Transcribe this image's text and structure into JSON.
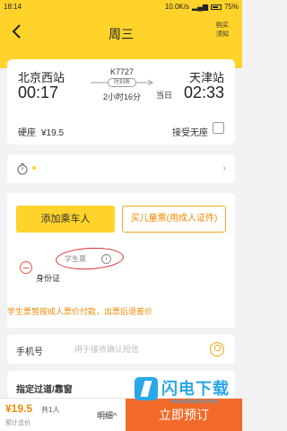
{
  "status_bar": {
    "time": "18:14",
    "speed": "10.0K/s",
    "battery": "75%"
  },
  "header": {
    "title": "周三",
    "help_line1": "购买",
    "help_line2": "须知"
  },
  "trip": {
    "from_station": "北京西站",
    "to_station": "天津站",
    "depart_time": "00:17",
    "arrive_time": "02:33",
    "arrive_day": "当日",
    "train_no": "K7727",
    "timetable_label": "时刻表",
    "duration": "2小时16分",
    "seat_type": "硬座",
    "price": "¥19.5",
    "accept_no_seat": "接受无座"
  },
  "passenger": {
    "add_button": "添加乘车人",
    "child_button": "买儿童票(用成人证件)",
    "ticket_tag": "学生票",
    "id_type": "身份证",
    "note": "学生票暂按成人票价付款，出票后退差价"
  },
  "phone": {
    "label": "手机号",
    "placeholder": "用于接收确认短信",
    "value": ""
  },
  "seat_selection": {
    "label": "指定过道/靠窗"
  },
  "bottom": {
    "price": "¥19.5",
    "count": "共1人",
    "total_label": "预计总价",
    "detail_label": "明细^",
    "book_button": "立即预订"
  },
  "watermark": {
    "text": "闪电下载",
    "url": "www.dianxa.com"
  },
  "colors": {
    "brand_yellow": "#ffd329",
    "accent_orange": "#f08a00",
    "book_button": "#f26a2a",
    "mark_red": "#d33"
  }
}
